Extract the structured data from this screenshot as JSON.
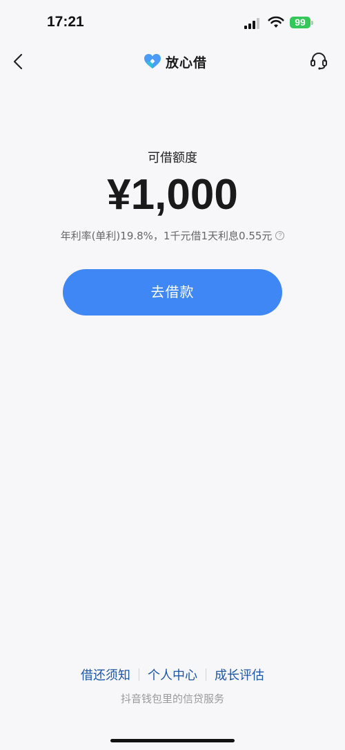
{
  "status_bar": {
    "time": "17:21",
    "battery": "99"
  },
  "nav": {
    "title": "放心借",
    "icons": {
      "back": "chevron-left-icon",
      "logo": "heart-logo-icon",
      "service": "headset-icon"
    }
  },
  "main": {
    "credit_label": "可借额度",
    "credit_amount": "¥1,000",
    "rate_text": "年利率(单利)19.8%，1千元借1天利息0.55元",
    "info_icon": "?",
    "borrow_button": "去借款"
  },
  "footer": {
    "links": [
      "借还须知",
      "个人中心",
      "成长评估"
    ],
    "note": "抖音钱包里的信贷服务"
  },
  "colors": {
    "accent": "#3f87f5",
    "link": "#1d56a6",
    "battery": "#34c759",
    "background": "#f7f7f9"
  }
}
